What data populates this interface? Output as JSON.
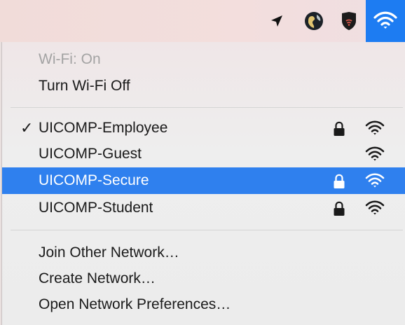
{
  "menubar": {
    "icons": [
      "location-arrow-icon",
      "globe-icon",
      "shield-icon",
      "wifi-status-icon"
    ],
    "accent": "#1d7cf2"
  },
  "menu": {
    "status_label": "Wi-Fi: On",
    "toggle_label": "Turn Wi-Fi Off",
    "networks": [
      {
        "name": "UICOMP-Employee",
        "connected": true,
        "locked": true
      },
      {
        "name": "UICOMP-Guest",
        "connected": false,
        "locked": false
      },
      {
        "name": "UICOMP-Secure",
        "connected": false,
        "locked": true,
        "highlighted": true
      },
      {
        "name": "UICOMP-Student",
        "connected": false,
        "locked": true
      }
    ],
    "check_mark": "✓",
    "join_other": "Join Other Network…",
    "create_network": "Create Network…",
    "open_prefs": "Open Network Preferences…",
    "highlight_color": "#2f80ee"
  }
}
